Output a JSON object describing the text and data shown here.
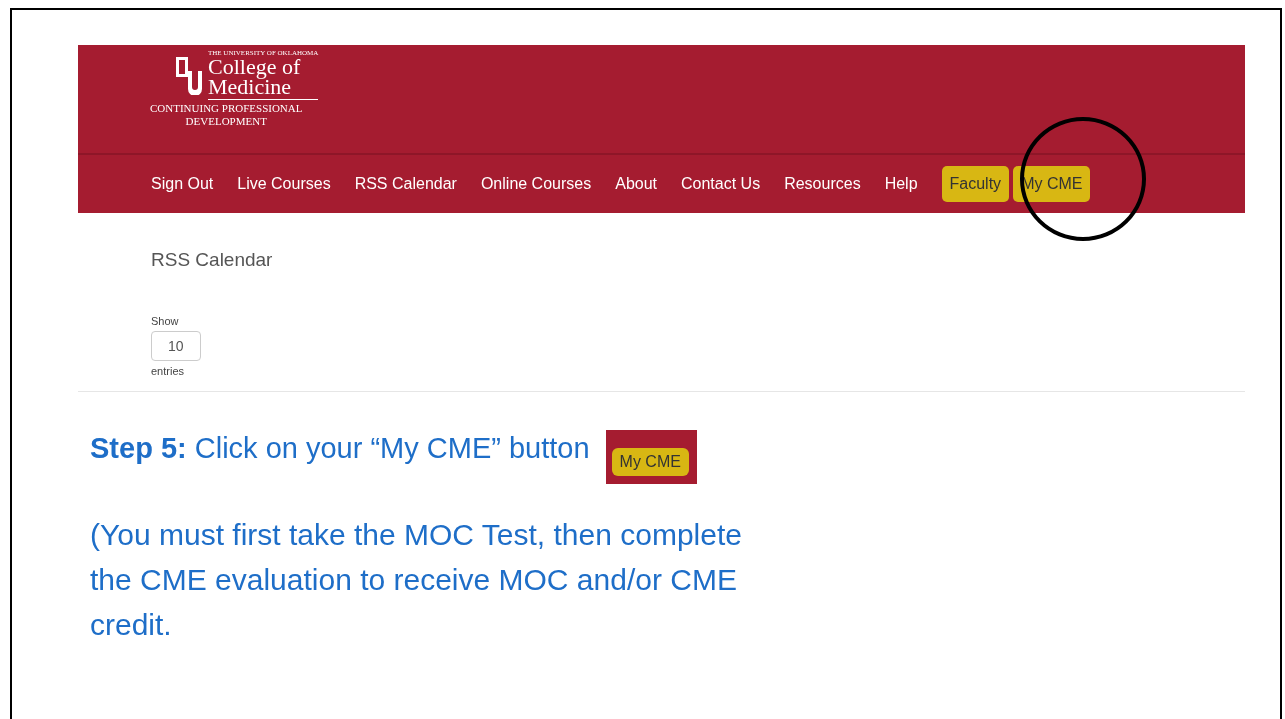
{
  "screenshot": {
    "logo": {
      "university": "THE UNIVERSITY OF OKLAHOMA",
      "name_line1": "College of",
      "name_line2": "Medicine",
      "subtitle_line1": "CONTINUING PROFESSIONAL",
      "subtitle_line2": "DEVELOPMENT"
    },
    "nav": [
      {
        "label": "Sign Out",
        "kind": "link"
      },
      {
        "label": "Live Courses",
        "kind": "link"
      },
      {
        "label": "RSS Calendar",
        "kind": "link"
      },
      {
        "label": "Online Courses",
        "kind": "link"
      },
      {
        "label": "About",
        "kind": "link"
      },
      {
        "label": "Contact Us",
        "kind": "link"
      },
      {
        "label": "Resources",
        "kind": "link"
      },
      {
        "label": "Help",
        "kind": "link"
      },
      {
        "label": "Faculty",
        "kind": "button"
      },
      {
        "label": "My CME",
        "kind": "button"
      }
    ],
    "page_title": "RSS Calendar",
    "show_label": "Show",
    "entries_value": "10",
    "entries_label": "entries"
  },
  "step": {
    "text": "**Step 5:** Click on your “My CME” button",
    "button_sample": "My CME"
  },
  "note": "(You must first take the MOC Test, then complete the CME evaluation to receive MOC and/or CME credit."
}
